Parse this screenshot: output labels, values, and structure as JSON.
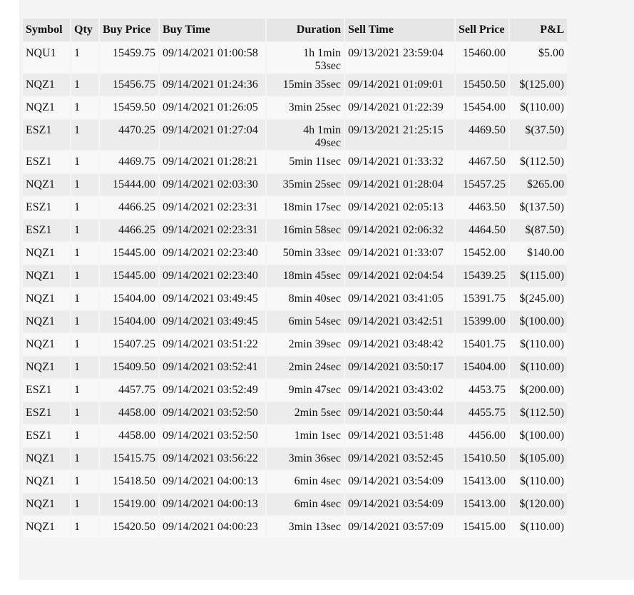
{
  "table": {
    "headers": {
      "symbol": "Symbol",
      "qty": "Qty",
      "buy_price": "Buy Price",
      "buy_time": "Buy Time",
      "duration": "Duration",
      "sell_time": "Sell Time",
      "sell_price": "Sell Price",
      "pnl": "P&L"
    },
    "rows": [
      {
        "symbol": "NQU1",
        "qty": "1",
        "buy_price": "15459.75",
        "buy_time": "09/14/2021 01:00:58",
        "duration": [
          "1h 1min",
          "53sec"
        ],
        "sell_time": "09/13/2021 23:59:04",
        "sell_price": "15460.00",
        "pnl": "$5.00"
      },
      {
        "symbol": "NQZ1",
        "qty": "1",
        "buy_price": "15456.75",
        "buy_time": "09/14/2021 01:24:36",
        "duration": [
          "15min 35sec"
        ],
        "sell_time": "09/14/2021 01:09:01",
        "sell_price": "15450.50",
        "pnl": "$(125.00)"
      },
      {
        "symbol": "NQZ1",
        "qty": "1",
        "buy_price": "15459.50",
        "buy_time": "09/14/2021 01:26:05",
        "duration": [
          "3min 25sec"
        ],
        "sell_time": "09/14/2021 01:22:39",
        "sell_price": "15454.00",
        "pnl": "$(110.00)"
      },
      {
        "symbol": "ESZ1",
        "qty": "1",
        "buy_price": "4470.25",
        "buy_time": "09/14/2021 01:27:04",
        "duration": [
          "4h 1min",
          "49sec"
        ],
        "sell_time": "09/13/2021 21:25:15",
        "sell_price": "4469.50",
        "pnl": "$(37.50)"
      },
      {
        "symbol": "ESZ1",
        "qty": "1",
        "buy_price": "4469.75",
        "buy_time": "09/14/2021 01:28:21",
        "duration": [
          "5min 11sec"
        ],
        "sell_time": "09/14/2021 01:33:32",
        "sell_price": "4467.50",
        "pnl": "$(112.50)"
      },
      {
        "symbol": "NQZ1",
        "qty": "1",
        "buy_price": "15444.00",
        "buy_time": "09/14/2021 02:03:30",
        "duration": [
          "35min 25sec"
        ],
        "sell_time": "09/14/2021 01:28:04",
        "sell_price": "15457.25",
        "pnl": "$265.00"
      },
      {
        "symbol": "ESZ1",
        "qty": "1",
        "buy_price": "4466.25",
        "buy_time": "09/14/2021 02:23:31",
        "duration": [
          "18min 17sec"
        ],
        "sell_time": "09/14/2021 02:05:13",
        "sell_price": "4463.50",
        "pnl": "$(137.50)"
      },
      {
        "symbol": "ESZ1",
        "qty": "1",
        "buy_price": "4466.25",
        "buy_time": "09/14/2021 02:23:31",
        "duration": [
          "16min 58sec"
        ],
        "sell_time": "09/14/2021 02:06:32",
        "sell_price": "4464.50",
        "pnl": "$(87.50)"
      },
      {
        "symbol": "NQZ1",
        "qty": "1",
        "buy_price": "15445.00",
        "buy_time": "09/14/2021 02:23:40",
        "duration": [
          "50min 33sec"
        ],
        "sell_time": "09/14/2021 01:33:07",
        "sell_price": "15452.00",
        "pnl": "$140.00"
      },
      {
        "symbol": "NQZ1",
        "qty": "1",
        "buy_price": "15445.00",
        "buy_time": "09/14/2021 02:23:40",
        "duration": [
          "18min 45sec"
        ],
        "sell_time": "09/14/2021 02:04:54",
        "sell_price": "15439.25",
        "pnl": "$(115.00)"
      },
      {
        "symbol": "NQZ1",
        "qty": "1",
        "buy_price": "15404.00",
        "buy_time": "09/14/2021 03:49:45",
        "duration": [
          "8min 40sec"
        ],
        "sell_time": "09/14/2021 03:41:05",
        "sell_price": "15391.75",
        "pnl": "$(245.00)"
      },
      {
        "symbol": "NQZ1",
        "qty": "1",
        "buy_price": "15404.00",
        "buy_time": "09/14/2021 03:49:45",
        "duration": [
          "6min 54sec"
        ],
        "sell_time": "09/14/2021 03:42:51",
        "sell_price": "15399.00",
        "pnl": "$(100.00)"
      },
      {
        "symbol": "NQZ1",
        "qty": "1",
        "buy_price": "15407.25",
        "buy_time": "09/14/2021 03:51:22",
        "duration": [
          "2min 39sec"
        ],
        "sell_time": "09/14/2021 03:48:42",
        "sell_price": "15401.75",
        "pnl": "$(110.00)"
      },
      {
        "symbol": "NQZ1",
        "qty": "1",
        "buy_price": "15409.50",
        "buy_time": "09/14/2021 03:52:41",
        "duration": [
          "2min 24sec"
        ],
        "sell_time": "09/14/2021 03:50:17",
        "sell_price": "15404.00",
        "pnl": "$(110.00)"
      },
      {
        "symbol": "ESZ1",
        "qty": "1",
        "buy_price": "4457.75",
        "buy_time": "09/14/2021 03:52:49",
        "duration": [
          "9min 47sec"
        ],
        "sell_time": "09/14/2021 03:43:02",
        "sell_price": "4453.75",
        "pnl": "$(200.00)"
      },
      {
        "symbol": "ESZ1",
        "qty": "1",
        "buy_price": "4458.00",
        "buy_time": "09/14/2021 03:52:50",
        "duration": [
          "2min 5sec"
        ],
        "sell_time": "09/14/2021 03:50:44",
        "sell_price": "4455.75",
        "pnl": "$(112.50)"
      },
      {
        "symbol": "ESZ1",
        "qty": "1",
        "buy_price": "4458.00",
        "buy_time": "09/14/2021 03:52:50",
        "duration": [
          "1min 1sec"
        ],
        "sell_time": "09/14/2021 03:51:48",
        "sell_price": "4456.00",
        "pnl": "$(100.00)"
      },
      {
        "symbol": "NQZ1",
        "qty": "1",
        "buy_price": "15415.75",
        "buy_time": "09/14/2021 03:56:22",
        "duration": [
          "3min 36sec"
        ],
        "sell_time": "09/14/2021 03:52:45",
        "sell_price": "15410.50",
        "pnl": "$(105.00)"
      },
      {
        "symbol": "NQZ1",
        "qty": "1",
        "buy_price": "15418.50",
        "buy_time": "09/14/2021 04:00:13",
        "duration": [
          "6min 4sec"
        ],
        "sell_time": "09/14/2021 03:54:09",
        "sell_price": "15413.00",
        "pnl": "$(110.00)"
      },
      {
        "symbol": "NQZ1",
        "qty": "1",
        "buy_price": "15419.00",
        "buy_time": "09/14/2021 04:00:13",
        "duration": [
          "6min 4sec"
        ],
        "sell_time": "09/14/2021 03:54:09",
        "sell_price": "15413.00",
        "pnl": "$(120.00)"
      },
      {
        "symbol": "NQZ1",
        "qty": "1",
        "buy_price": "15420.50",
        "buy_time": "09/14/2021 04:00:23",
        "duration": [
          "3min 13sec"
        ],
        "sell_time": "09/14/2021 03:57:09",
        "sell_price": "15415.00",
        "pnl": "$(110.00)"
      }
    ]
  }
}
